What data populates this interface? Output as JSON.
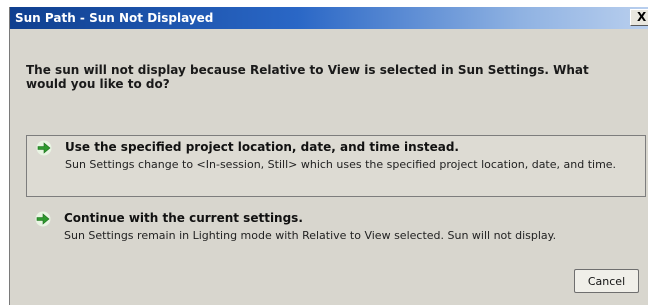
{
  "window": {
    "title": "Sun Path - Sun Not Displayed",
    "close_glyph": "X"
  },
  "instruction": "The sun will not display because Relative to View is selected in Sun Settings. What would you like to do?",
  "commands": [
    {
      "heading": "Use the specified project location, date, and time instead.",
      "description": "Sun Settings change to <In-session, Still> which uses the specified project location, date, and time.",
      "icon": "green-arrow-icon"
    },
    {
      "heading": "Continue with the current settings.",
      "description": "Sun Settings remain in Lighting mode with Relative to View selected. Sun will not display.",
      "icon": "green-arrow-icon"
    }
  ],
  "buttons": {
    "cancel": "Cancel"
  },
  "colors": {
    "title_bar_start": "#0f3f8f",
    "title_bar_end": "#b9cfee",
    "dialog_bg": "#d8d6ce",
    "arrow_green": "#2e9a2e"
  }
}
